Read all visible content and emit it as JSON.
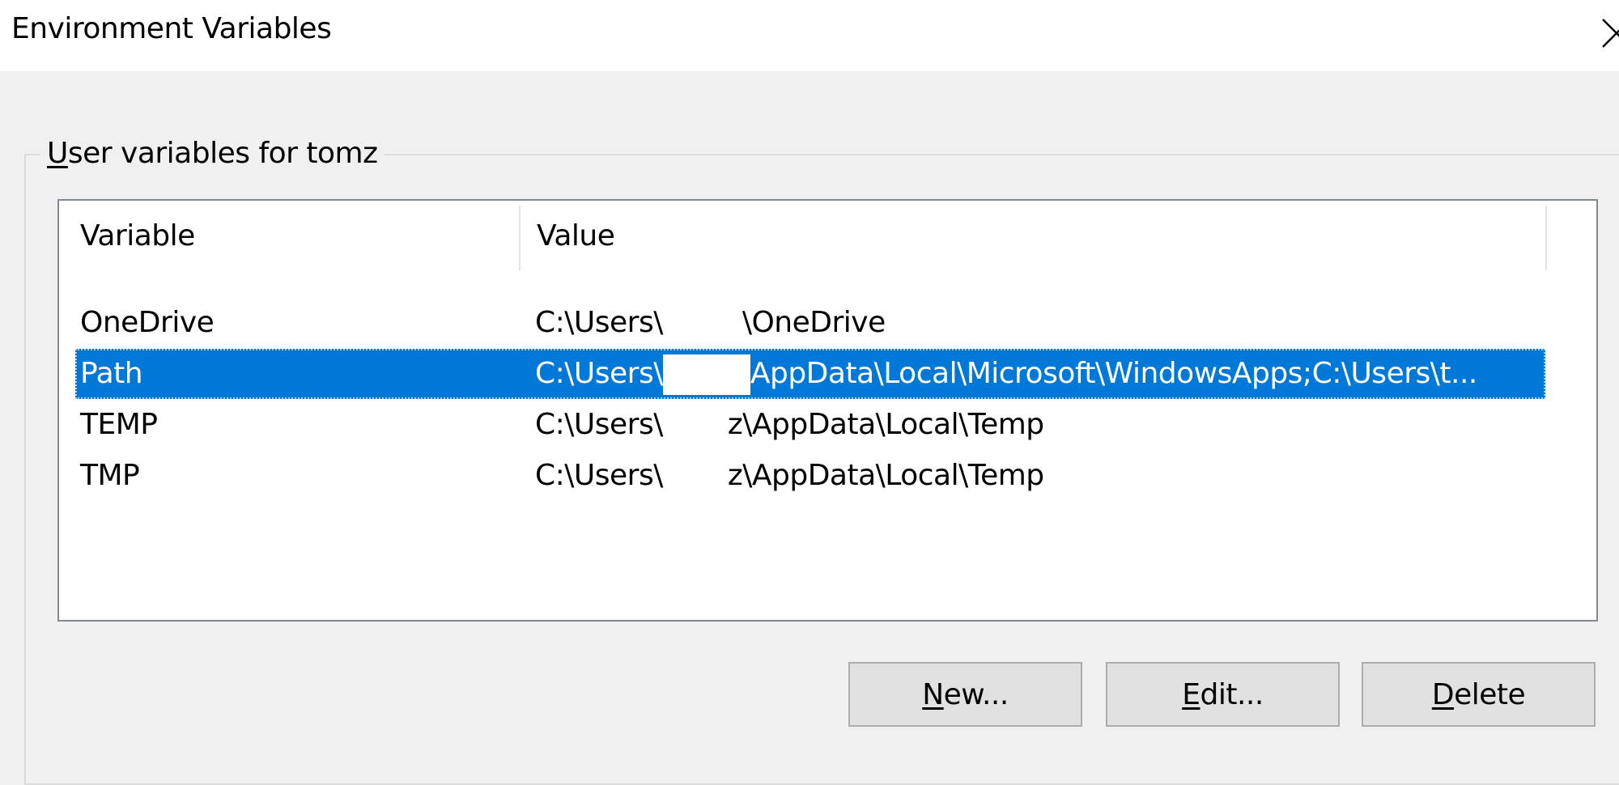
{
  "window": {
    "title": "Environment Variables",
    "close_icon": "close-icon"
  },
  "group": {
    "label_mnemonic": "U",
    "label_rest": "ser variables for tomz"
  },
  "table": {
    "columns": [
      "Variable",
      "Value"
    ],
    "rows": [
      {
        "variable": "OneDrive",
        "value_prefix": "C:\\Users\\",
        "value_suffix": "\\OneDrive",
        "selected": false
      },
      {
        "variable": "Path",
        "value_prefix": "C:\\Users\\",
        "value_suffix": "AppData\\Local\\Microsoft\\WindowsApps;C:\\Users\\t...",
        "selected": true
      },
      {
        "variable": "TEMP",
        "value_prefix": "C:\\Users\\",
        "value_suffix": "z\\AppData\\Local\\Temp",
        "selected": false
      },
      {
        "variable": "TMP",
        "value_prefix": "C:\\Users\\",
        "value_suffix": "z\\AppData\\Local\\Temp",
        "selected": false
      }
    ]
  },
  "buttons": {
    "new": {
      "mnemonic": "N",
      "rest": "ew..."
    },
    "edit": {
      "mnemonic": "E",
      "rest": "dit..."
    },
    "delete": {
      "mnemonic": "D",
      "rest": "elete"
    }
  },
  "colors": {
    "selection": "#0078d7",
    "window_bg": "#f0f0f0"
  }
}
